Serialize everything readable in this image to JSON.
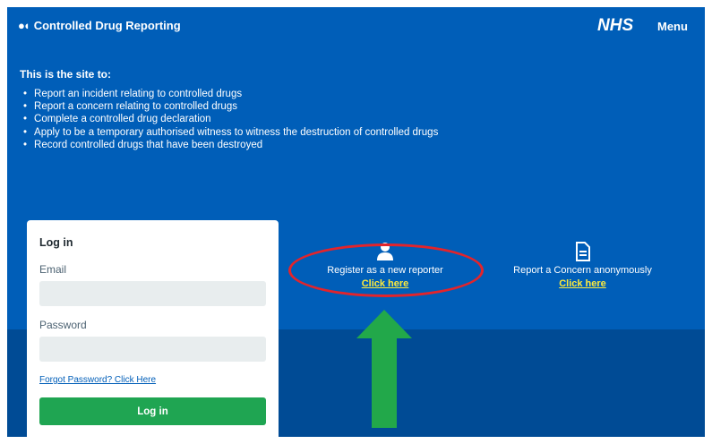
{
  "header": {
    "brand_text": "Controlled Drug Reporting",
    "logo": "NHS",
    "menu_label": "Menu"
  },
  "intro": {
    "title": "This is the site to:",
    "items": [
      "Report an incident relating to controlled drugs",
      "Report a concern relating to controlled drugs",
      "Complete a controlled drug declaration",
      "Apply to be a temporary authorised witness to witness the destruction of controlled drugs",
      "Record controlled drugs that have been destroyed"
    ]
  },
  "login": {
    "title": "Log in",
    "email_label": "Email",
    "email_value": "",
    "password_label": "Password",
    "password_value": "",
    "forgot_link": "Forgot Password? Click Here",
    "button_label": "Log in"
  },
  "options": {
    "register": {
      "icon": "user-icon",
      "label": "Register as a new reporter",
      "link": "Click here"
    },
    "concern": {
      "icon": "document-icon",
      "label": "Report a Concern anonymously",
      "link": "Click here"
    }
  },
  "annotations": {
    "ellipse_color": "#e3242b",
    "arrow_color": "#22a84a"
  },
  "colors": {
    "primary": "#005eb8",
    "dark": "#004b95",
    "button": "#1fa552",
    "link_highlight": "#ffeb3b"
  }
}
